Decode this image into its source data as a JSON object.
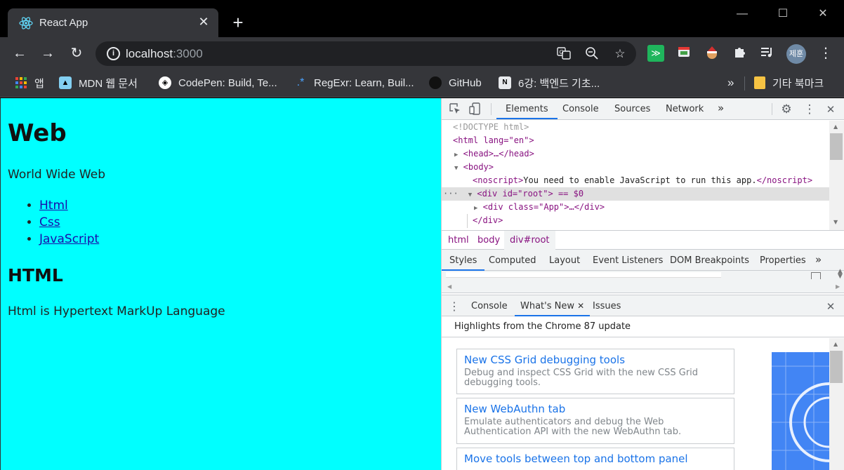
{
  "tab": {
    "title": "React App",
    "close_glyph": "✕"
  },
  "new_tab_glyph": "+",
  "window_controls": {
    "minimize": "—",
    "maximize": "☐",
    "close": "✕"
  },
  "toolbar": {
    "back": "←",
    "forward": "→",
    "reload": "↻",
    "url_host": "localhost",
    "url_port": ":3000",
    "profile_initials": "제훈"
  },
  "bookmarks": [
    {
      "label": "앱",
      "icon": "apps-grid-icon"
    },
    {
      "label": "MDN 웹 문서",
      "icon": "mdn-icon"
    },
    {
      "label": "CodePen: Build, Te...",
      "icon": "codepen-icon"
    },
    {
      "label": "RegExr: Learn, Buil...",
      "icon": "regexr-icon"
    },
    {
      "label": "GitHub",
      "icon": "github-icon"
    },
    {
      "label": "6강: 백엔드 기초...",
      "icon": "notion-icon"
    }
  ],
  "bookmarks_overflow": "»",
  "other_bookmarks": "기타 북마크",
  "page": {
    "h1": "Web",
    "p1": "World Wide Web",
    "links": [
      "Html",
      "Css",
      "JavaScript"
    ],
    "h2": "HTML",
    "p2": "Html is Hypertext MarkUp Language"
  },
  "devtools": {
    "tabs": [
      "Elements",
      "Console",
      "Sources",
      "Network"
    ],
    "active_tab": "Elements",
    "more": "»",
    "dom": {
      "doctype": "<!DOCTYPE html>",
      "html_open": "<html lang=\"en\">",
      "head": "<head>…</head>",
      "body_open": "<body>",
      "noscript_text": "You need to enable JavaScript to run this app.",
      "root_div": "<div id=\"root\"> == $0",
      "app_div": "<div class=\"App\">…</div>",
      "div_close": "</div>"
    },
    "breadcrumbs": [
      "html",
      "body",
      "div#root"
    ],
    "styles_tabs": [
      "Styles",
      "Computed",
      "Layout",
      "Event Listeners",
      "DOM Breakpoints",
      "Properties"
    ],
    "drawer_tabs": [
      "Console",
      "What's New",
      "Issues"
    ],
    "highlights": "Highlights from the Chrome 87 update",
    "cards": [
      {
        "title": "New CSS Grid debugging tools",
        "desc": "Debug and inspect CSS Grid with the new CSS Grid debugging tools."
      },
      {
        "title": "New WebAuthn tab",
        "desc": "Emulate authenticators and debug the Web Authentication API with the new WebAuthn tab."
      },
      {
        "title": "Move tools between top and bottom panel",
        "desc": ""
      }
    ]
  },
  "colors": {
    "page_bg": "#00ffff",
    "link": "#1a0dab",
    "devtools_accent": "#1a73e8"
  }
}
